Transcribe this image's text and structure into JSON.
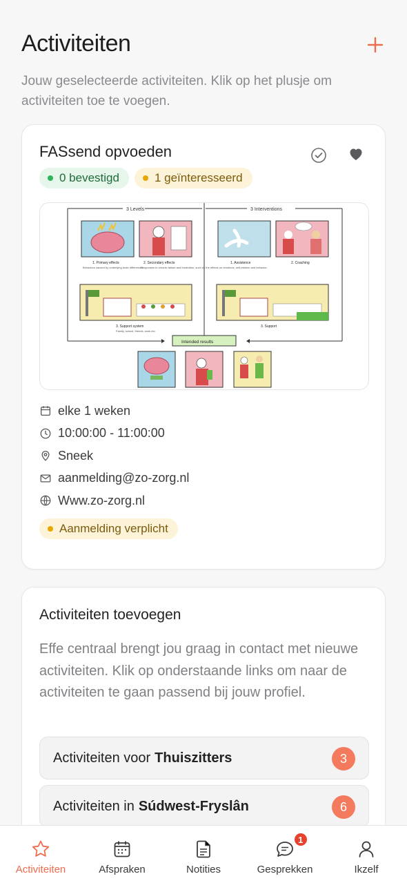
{
  "header": {
    "title": "Activiteiten",
    "add_icon": "plus-icon",
    "subtitle": "Jouw geselecteerde activiteiten. Klik op het plusje om activiteiten toe te voegen."
  },
  "activity": {
    "title": "FASsend opvoeden",
    "confirmed": "0 bevestigd",
    "interested": "1 geïnteresseerd",
    "image": {
      "left_heading": "3 Levels",
      "right_heading": "3 Interventions",
      "primary": "1. Primary effects",
      "primary_sub": "Behaviors caused by underlying brain differences",
      "secondary": "2. Secondary effects",
      "secondary_sub": "Responses to chronic failure and frustration, such as the effects on emotions, self-esteem and behavior.",
      "assistance": "1. Assistence",
      "coaching": "2. Coaching",
      "support_system": "3. Support system",
      "support_system_sub": "Family, school, friends, work etc.",
      "support": "3. Support",
      "intended": "Intended results"
    },
    "schedule": "elke 1 weken",
    "time": "10:00:00 - 11:00:00",
    "location": "Sneek",
    "email": "aanmelding@zo-zorg.nl",
    "website": "Www.zo-zorg.nl",
    "registration": "Aanmelding verplicht"
  },
  "add_section": {
    "title": "Activiteiten toevoegen",
    "text": "Effe centraal brengt jou graag in contact met nieuwe activiteiten. Klik op onderstaande links om naar de activiteiten te gaan passend bij jouw profiel.",
    "links": [
      {
        "prefix": "Activiteiten voor",
        "bold": "Thuiszitters",
        "count": "3"
      },
      {
        "prefix": "Activiteiten in",
        "bold": "Súdwest-Fryslân",
        "count": "6"
      }
    ]
  },
  "tabs": [
    {
      "label": "Activiteiten",
      "icon": "star-icon"
    },
    {
      "label": "Afspraken",
      "icon": "calendar-icon"
    },
    {
      "label": "Notities",
      "icon": "document-icon"
    },
    {
      "label": "Gesprekken",
      "icon": "chat-icon",
      "badge": "1"
    },
    {
      "label": "Ikzelf",
      "icon": "user-icon"
    }
  ],
  "colors": {
    "accent": "#ef6b4e",
    "badge_count": "#f47a5e",
    "green_dot": "#2fb55a",
    "yellow_dot": "#e6a800"
  }
}
